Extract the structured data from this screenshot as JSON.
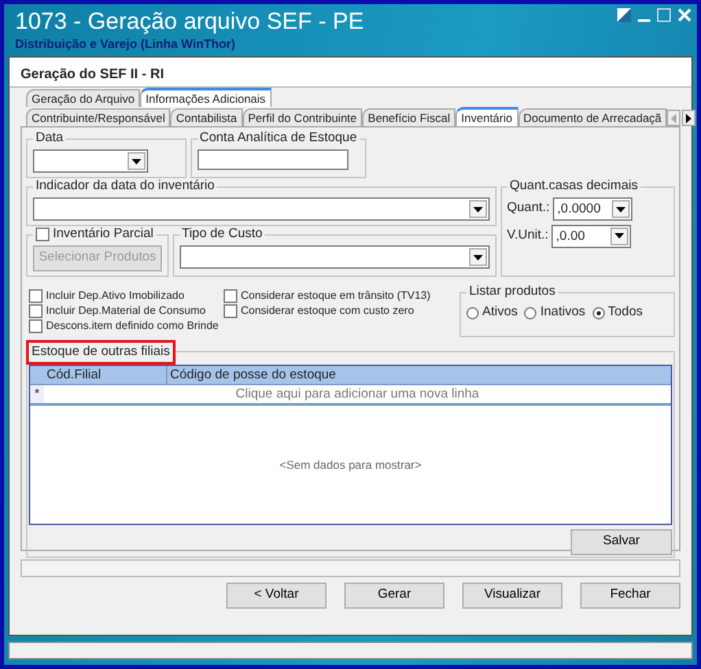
{
  "window": {
    "title": "1073 - Geração arquivo SEF - PE",
    "subtitle": "Distribuição e Varejo (Linha WinThor)"
  },
  "panel_title": "Geração do SEF II - RI",
  "main_tabs": [
    {
      "label": "Geração do Arquivo",
      "selected": false
    },
    {
      "label": "Informações Adicionais",
      "selected": true
    }
  ],
  "sub_tabs": [
    {
      "label": "Contribuinte/Responsável",
      "selected": false
    },
    {
      "label": "Contabilista",
      "selected": false
    },
    {
      "label": "Perfil do Contribuinte",
      "selected": false
    },
    {
      "label": "Benefício Fiscal",
      "selected": false
    },
    {
      "label": "Inventário",
      "selected": true
    },
    {
      "label": "Documento de Arrecadaçã",
      "selected": false
    }
  ],
  "data": {
    "label": "Data"
  },
  "conta": {
    "label": "Conta Analítica de Estoque"
  },
  "indicador": {
    "label": "Indicador da data do inventário"
  },
  "decimais": {
    "label": "Quant.casas decimais",
    "fields": [
      {
        "label": "Quant.:",
        "value": ",0.0000"
      },
      {
        "label": "V.Unit.:",
        "value": ",0.00"
      }
    ]
  },
  "inventario_parcial": {
    "label": "Inventário Parcial",
    "checked": false,
    "button": "Selecionar Produtos",
    "button_disabled": true
  },
  "tipo_custo": {
    "label": "Tipo de Custo"
  },
  "options": [
    {
      "label": "Incluir Dep.Ativo Imobilizado",
      "checked": false
    },
    {
      "label": "Incluir Dep.Material de Consumo",
      "checked": false
    },
    {
      "label": "Descons.item definido como Brinde",
      "checked": false
    },
    {
      "label": "Considerar estoque em trânsito (TV13)",
      "checked": false
    },
    {
      "label": "Considerar estoque com custo zero",
      "checked": false
    }
  ],
  "listar": {
    "label": "Listar produtos",
    "options": [
      {
        "label": "Ativos",
        "selected": false
      },
      {
        "label": "Inativos",
        "selected": false
      },
      {
        "label": "Todos",
        "selected": true
      }
    ]
  },
  "estoque": {
    "label": "Estoque de outras filiais",
    "highlighted": true,
    "columns": [
      "Cód.Filial",
      "Código de posse do estoque"
    ],
    "new_row_marker": "*",
    "new_row_text": "Clique aqui para adicionar uma nova linha",
    "empty_text": "<Sem dados para mostrar>",
    "save_button": "Salvar"
  },
  "progress": {
    "level": 0
  },
  "buttons": [
    "< Voltar",
    "Gerar",
    "Visualizar",
    "Fechar"
  ]
}
